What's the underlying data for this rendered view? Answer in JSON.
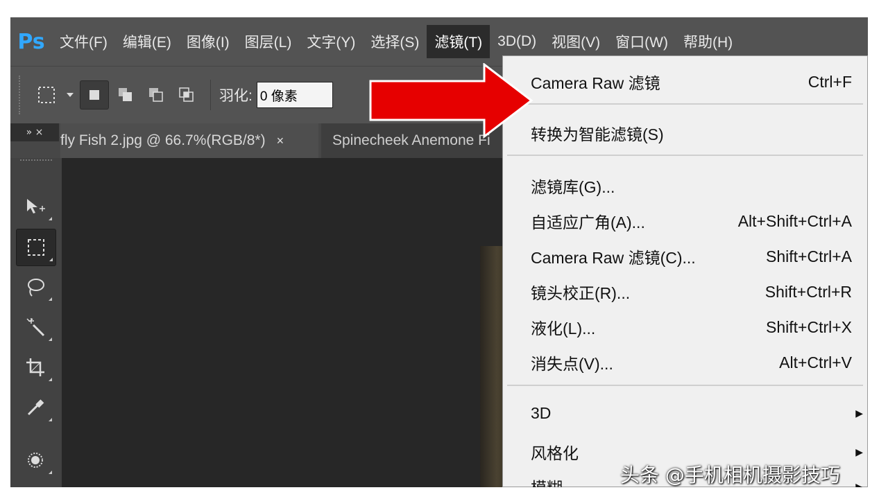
{
  "app": {
    "logo": "Ps"
  },
  "menubar": {
    "items": [
      "文件(F)",
      "编辑(E)",
      "图像(I)",
      "图层(L)",
      "文字(Y)",
      "选择(S)",
      "滤镜(T)",
      "3D(D)",
      "视图(V)",
      "窗口(W)",
      "帮助(H)"
    ],
    "active": "滤镜(T)"
  },
  "options": {
    "feather_label": "羽化:",
    "feather_value": "0 像素"
  },
  "tabs": {
    "collapse_glyphs": "»  ×",
    "tab1": "fly Fish 2.jpg @ 66.7%(RGB/8*)",
    "tab1_close": "×",
    "tab2": "Spinecheek Anemone Fi"
  },
  "tools": [
    "move-tool",
    "marquee-tool",
    "lasso-tool",
    "magic-wand-tool",
    "crop-tool",
    "eyedropper-tool",
    "brush-tool"
  ],
  "dropdown": {
    "last_filter": {
      "label": "Camera Raw 滤镜",
      "shortcut": "Ctrl+F"
    },
    "smart_filter": {
      "label": "转换为智能滤镜(S)"
    },
    "items": [
      {
        "label": "滤镜库(G)...",
        "shortcut": ""
      },
      {
        "label": "自适应广角(A)...",
        "shortcut": "Alt+Shift+Ctrl+A"
      },
      {
        "label": "Camera Raw 滤镜(C)...",
        "shortcut": "Shift+Ctrl+A"
      },
      {
        "label": "镜头校正(R)...",
        "shortcut": "Shift+Ctrl+R"
      },
      {
        "label": "液化(L)...",
        "shortcut": "Shift+Ctrl+X"
      },
      {
        "label": "消失点(V)...",
        "shortcut": "Alt+Ctrl+V"
      }
    ],
    "submenus": [
      {
        "label": "3D",
        "arrow": "▶"
      },
      {
        "label": "风格化",
        "arrow": "▶"
      },
      {
        "label": "模糊",
        "arrow": "▶"
      }
    ]
  },
  "watermark": "头条 @手机相机摄影技巧",
  "colors": {
    "arrow_red": "#e60000",
    "ps_blue": "#31a8ff",
    "menubar": "#535353"
  }
}
